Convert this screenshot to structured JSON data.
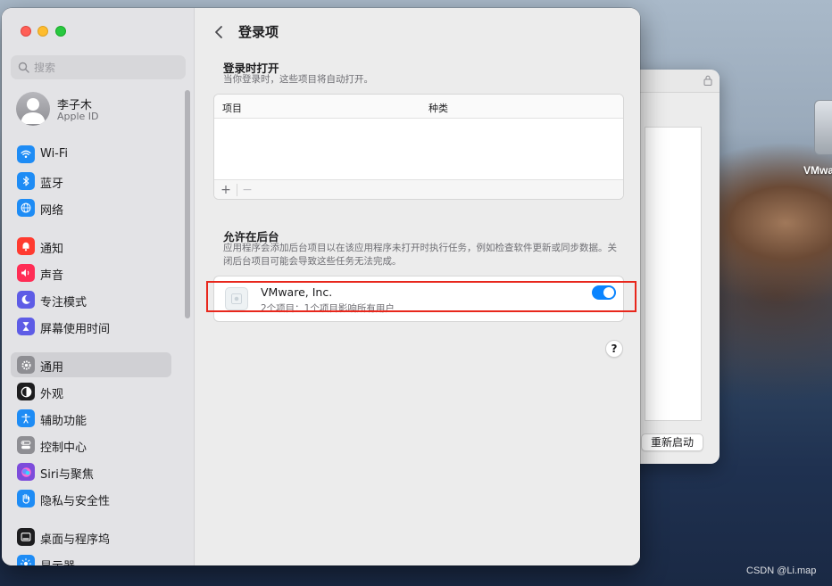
{
  "sidebar": {
    "search_placeholder": "搜索",
    "account": {
      "name": "李子木",
      "subtitle": "Apple ID"
    },
    "items": [
      {
        "label": "Wi-Fi",
        "icon": "wifi-icon",
        "color": "#1e8cf5"
      },
      {
        "label": "蓝牙",
        "icon": "bluetooth-icon",
        "color": "#1e8cf5"
      },
      {
        "label": "网络",
        "icon": "globe-icon",
        "color": "#1e8cf5"
      },
      {
        "label": "通知",
        "icon": "bell-icon",
        "color": "#ff3b30"
      },
      {
        "label": "声音",
        "icon": "speaker-icon",
        "color": "#ff2d55"
      },
      {
        "label": "专注模式",
        "icon": "moon-icon",
        "color": "#5e5ce6"
      },
      {
        "label": "屏幕使用时间",
        "icon": "hourglass-icon",
        "color": "#5e5ce6"
      },
      {
        "label": "通用",
        "icon": "gear-icon",
        "color": "#8e8e93",
        "active": true
      },
      {
        "label": "外观",
        "icon": "appearance-icon",
        "color": "#1d1d1f"
      },
      {
        "label": "辅助功能",
        "icon": "accessibility-icon",
        "color": "#1e8cf5"
      },
      {
        "label": "控制中心",
        "icon": "control-center-icon",
        "color": "#8e8e93"
      },
      {
        "label": "Siri与聚焦",
        "icon": "siri-icon",
        "color": "#7d4cdb"
      },
      {
        "label": "隐私与安全性",
        "icon": "hand-icon",
        "color": "#1e8cf5"
      },
      {
        "label": "桌面与程序坞",
        "icon": "dock-icon",
        "color": "#1d1d1f"
      },
      {
        "label": "显示器",
        "icon": "display-icon",
        "color": "#1e8cf5"
      }
    ]
  },
  "content": {
    "title": "登录项",
    "login": {
      "title": "登录时打开",
      "description": "当你登录时，这些项目将自动打开。",
      "columns": [
        "项目",
        "种类"
      ],
      "add_label": "+",
      "remove_label": "−"
    },
    "background": {
      "title": "允许在后台",
      "description": "应用程序会添加后台项目以在该应用程序未打开时执行任务，例如检查软件更新或同步数据。关闭后台项目可能会导致这些任务无法完成。",
      "items": [
        {
          "name": "VMware, Inc.",
          "subtitle": "2个项目：1个项目影响所有用户",
          "enabled": true
        }
      ]
    },
    "help_label": "?"
  },
  "background_window": {
    "button_label": "重新启动"
  },
  "desktop": {
    "icon_label": "VMwa"
  },
  "watermark": "CSDN @Li.map",
  "colors": {
    "accent": "#0a84ff",
    "highlight_border": "#e8271c"
  }
}
